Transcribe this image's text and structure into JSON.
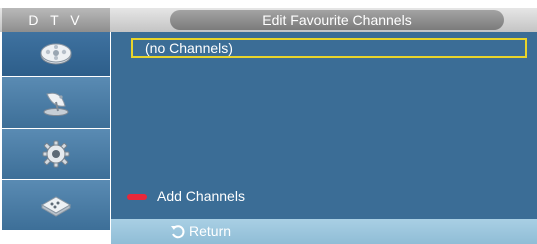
{
  "header": {
    "source_label": "D T V",
    "title": "Edit Favourite Channels"
  },
  "sidebar": {
    "items": [
      {
        "icon": "film-reel-icon"
      },
      {
        "icon": "satellite-dish-icon"
      },
      {
        "icon": "gear-icon"
      },
      {
        "icon": "remote-control-icon"
      }
    ]
  },
  "main": {
    "channels_label": "(no Channels)",
    "add_channels_label": "Add Channels"
  },
  "footer": {
    "return_label": "Return"
  },
  "colors": {
    "panel_bg": "#3b6d96",
    "highlight_border": "#e8d42a",
    "red_key": "#e8283a",
    "footer_bg": "#a9cfe4"
  }
}
